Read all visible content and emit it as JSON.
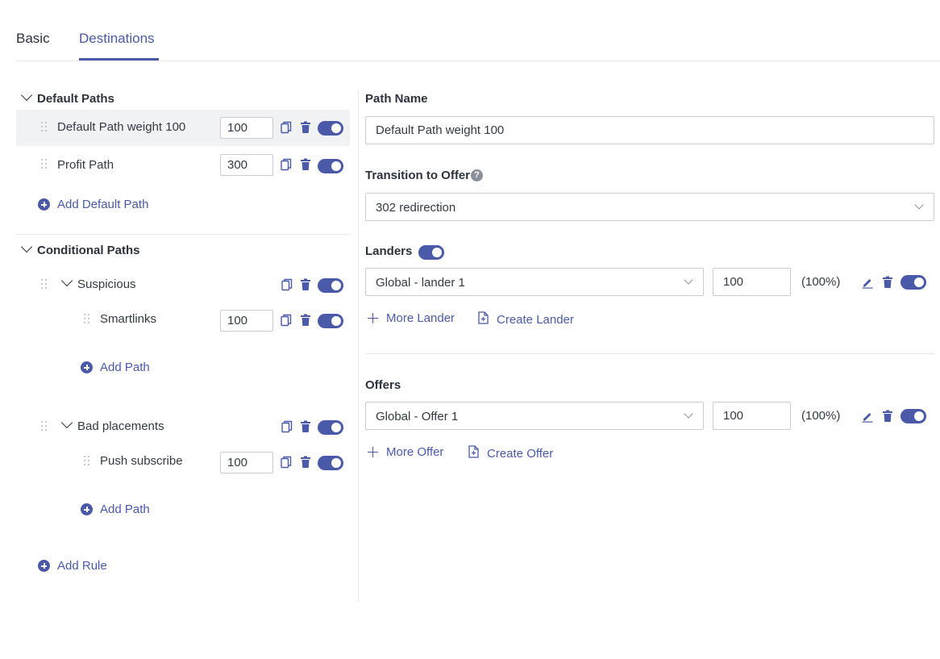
{
  "tabs": [
    {
      "label": "Basic",
      "active": false
    },
    {
      "label": "Destinations",
      "active": true
    }
  ],
  "left": {
    "default_paths": {
      "title": "Default Paths",
      "items": [
        {
          "label": "Default Path weight 100",
          "weight": "100",
          "enabled": true,
          "selected": true
        },
        {
          "label": "Profit Path",
          "weight": "300",
          "enabled": true,
          "selected": false
        }
      ],
      "add_label": "Add Default Path"
    },
    "conditional_paths": {
      "title": "Conditional Paths",
      "rules": [
        {
          "label": "Suspicious",
          "enabled": true,
          "paths": [
            {
              "label": "Smartlinks",
              "weight": "100",
              "enabled": true
            }
          ],
          "add_label": "Add Path"
        },
        {
          "label": "Bad placements",
          "enabled": true,
          "paths": [
            {
              "label": "Push subscribe",
              "weight": "100",
              "enabled": true
            }
          ],
          "add_label": "Add Path"
        }
      ],
      "add_rule_label": "Add Rule"
    }
  },
  "right": {
    "path_name": {
      "label": "Path Name",
      "value": "Default Path weight 100"
    },
    "transition": {
      "label": "Transition to Offer",
      "help": "?",
      "value": "302 redirection"
    },
    "landers": {
      "label": "Landers",
      "enabled": true,
      "items": [
        {
          "name": "Global - lander 1",
          "weight": "100",
          "percent": "(100%)",
          "enabled": true
        }
      ],
      "more_label": "More Lander",
      "create_label": "Create Lander"
    },
    "offers": {
      "label": "Offers",
      "items": [
        {
          "name": "Global - Offer 1",
          "weight": "100",
          "percent": "(100%)",
          "enabled": true
        }
      ],
      "more_label": "More Offer",
      "create_label": "Create Offer"
    }
  },
  "colors": {
    "accent": "#4a5aa8",
    "border": "#c9cdd3",
    "highlight": "#f1f2f4"
  }
}
